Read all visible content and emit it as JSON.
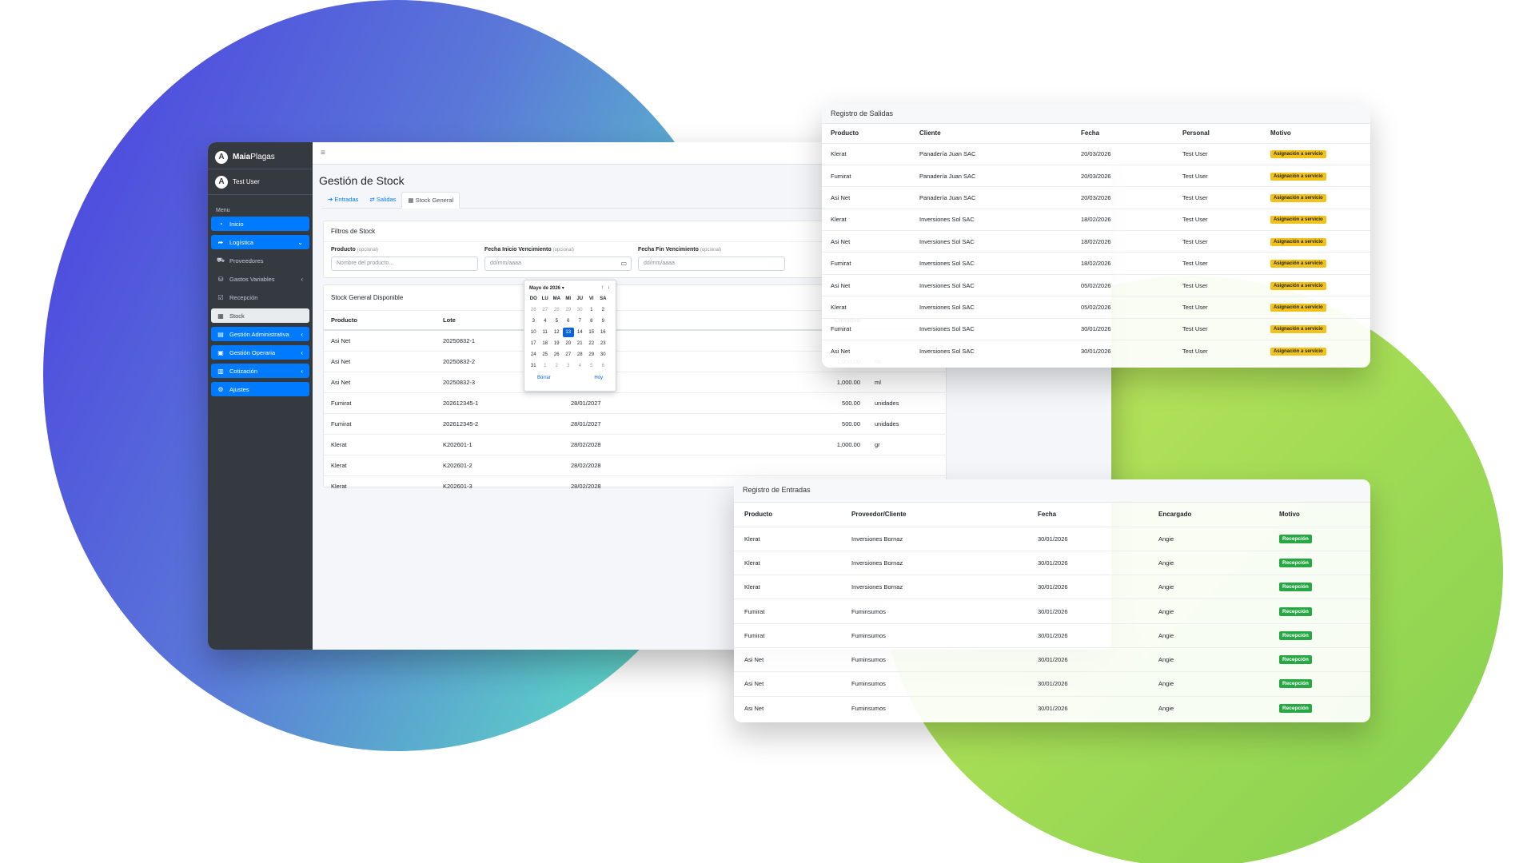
{
  "brand": {
    "name_bold": "Maia",
    "name_rest": "Plagas",
    "logo_letter": "A"
  },
  "user": {
    "name": "Test User"
  },
  "sidebar": {
    "menu_header": "Menu",
    "items": [
      {
        "label": "Inicio",
        "icon": "dashboard-icon",
        "glyph": "◔",
        "chev": ""
      },
      {
        "label": "Logística",
        "icon": "share-arrow-icon",
        "glyph": "➦",
        "chev": "⌄"
      },
      {
        "label": "Proveedores",
        "icon": "truck-icon",
        "glyph": "⛟",
        "chev": ""
      },
      {
        "label": "Gastos Variables",
        "icon": "coins-icon",
        "glyph": "⛁",
        "chev": "‹"
      },
      {
        "label": "Recepción",
        "icon": "check-box-icon",
        "glyph": "☑",
        "chev": ""
      },
      {
        "label": "Stock",
        "icon": "boxes-icon",
        "glyph": "▦",
        "chev": ""
      },
      {
        "label": "Gestión Administrativa",
        "icon": "document-icon",
        "glyph": "▤",
        "chev": "‹"
      },
      {
        "label": "Gestión Operaria",
        "icon": "briefcase-icon",
        "glyph": "▣",
        "chev": "‹"
      },
      {
        "label": "Cotización",
        "icon": "file-icon",
        "glyph": "▥",
        "chev": "‹"
      },
      {
        "label": "Ajustes",
        "icon": "gear-icon",
        "glyph": "⚙",
        "chev": ""
      }
    ]
  },
  "topbar": {
    "menu_glyph": "≡"
  },
  "page": {
    "title": "Gestión de Stock",
    "tabs": [
      {
        "label": "Entradas",
        "glyph": "➔"
      },
      {
        "label": "Salidas",
        "glyph": "⇄"
      },
      {
        "label": "Stock General",
        "glyph": "▦"
      }
    ]
  },
  "filters": {
    "title": "Filtros de Stock",
    "producto_label": "Producto",
    "optional": "(opcional)",
    "producto_placeholder": "Nombre del producto...",
    "fecha_inicio_label": "Fecha Inicio Vencimiento",
    "fecha_fin_label": "Fecha Fin Vencimiento",
    "date_placeholder": "dd/mm/aaaa"
  },
  "stock": {
    "title": "Stock General Disponible",
    "columns": [
      "Producto",
      "Lote",
      "cimiento",
      "Cantidad"
    ],
    "rows": [
      {
        "producto": "Asi Net",
        "lote": "20250832-1",
        "fecha": "",
        "cantidad": "",
        "unidad": ""
      },
      {
        "producto": "Asi Net",
        "lote": "20250832-2",
        "fecha": "",
        "cantidad": "1,000.00",
        "unidad": "ml"
      },
      {
        "producto": "Asi Net",
        "lote": "20250832-3",
        "fecha": "",
        "cantidad": "1,000.00",
        "unidad": "ml"
      },
      {
        "producto": "Fumirat",
        "lote": "202612345-1",
        "fecha": "28/01/2027",
        "cantidad": "500.00",
        "unidad": "unidades"
      },
      {
        "producto": "Fumirat",
        "lote": "202612345-2",
        "fecha": "28/01/2027",
        "cantidad": "500.00",
        "unidad": "unidades"
      },
      {
        "producto": "Klerat",
        "lote": "K202601-1",
        "fecha": "28/02/2028",
        "cantidad": "1,000.00",
        "unidad": "gr"
      },
      {
        "producto": "Klerat",
        "lote": "K202601-2",
        "fecha": "28/02/2028",
        "cantidad": "",
        "unidad": ""
      },
      {
        "producto": "Klerat",
        "lote": "K202601-3",
        "fecha": "28/02/2028",
        "cantidad": "",
        "unidad": ""
      }
    ]
  },
  "datepicker": {
    "month_label": "Mayo de 2026 ▾",
    "up": "↑",
    "down": "↓",
    "weekdays": [
      "DO",
      "LU",
      "MA",
      "MI",
      "JU",
      "VI",
      "SA"
    ],
    "days": [
      "26",
      "27",
      "28",
      "29",
      "30",
      "1",
      "2",
      "3",
      "4",
      "5",
      "6",
      "7",
      "8",
      "9",
      "10",
      "11",
      "12",
      "13",
      "14",
      "15",
      "16",
      "17",
      "18",
      "19",
      "20",
      "21",
      "22",
      "23",
      "24",
      "25",
      "26",
      "27",
      "28",
      "29",
      "30",
      "31",
      "1",
      "2",
      "3",
      "4",
      "5",
      "6"
    ],
    "selected": "13",
    "clear": "Borrar",
    "today": "Hoy"
  },
  "salidas": {
    "title": "Registro de Salidas",
    "columns": [
      "Producto",
      "Cliente",
      "Fecha",
      "Personal",
      "Motivo"
    ],
    "rows": [
      {
        "producto": "Klerat",
        "cliente": "Panadería Juan SAC",
        "fecha": "20/03/2026",
        "personal": "Test User",
        "motivo": "Asignación a servicio"
      },
      {
        "producto": "Fumirat",
        "cliente": "Panadería Juan SAC",
        "fecha": "20/03/2026",
        "personal": "Test User",
        "motivo": "Asignación a servicio"
      },
      {
        "producto": "Asi Net",
        "cliente": "Panadería Juan SAC",
        "fecha": "20/03/2026",
        "personal": "Test User",
        "motivo": "Asignación a servicio"
      },
      {
        "producto": "Klerat",
        "cliente": "Inversiones Sol SAC",
        "fecha": "18/02/2026",
        "personal": "Test User",
        "motivo": "Asignación a servicio"
      },
      {
        "producto": "Asi Net",
        "cliente": "Inversiones Sol SAC",
        "fecha": "18/02/2026",
        "personal": "Test User",
        "motivo": "Asignación a servicio"
      },
      {
        "producto": "Fumirat",
        "cliente": "Inversiones Sol SAC",
        "fecha": "18/02/2026",
        "personal": "Test User",
        "motivo": "Asignación a servicio"
      },
      {
        "producto": "Asi Net",
        "cliente": "Inversiones Sol SAC",
        "fecha": "05/02/2026",
        "personal": "Test User",
        "motivo": "Asignación a servicio"
      },
      {
        "producto": "Klerat",
        "cliente": "Inversiones Sol SAC",
        "fecha": "05/02/2026",
        "personal": "Test User",
        "motivo": "Asignación a servicio"
      },
      {
        "producto": "Fumirat",
        "cliente": "Inversiones Sol SAC",
        "fecha": "30/01/2026",
        "personal": "Test User",
        "motivo": "Asignación a servicio"
      },
      {
        "producto": "Asi Net",
        "cliente": "Inversiones Sol SAC",
        "fecha": "30/01/2026",
        "personal": "Test User",
        "motivo": "Asignación a servicio"
      }
    ]
  },
  "entradas": {
    "title": "Registro de Entradas",
    "columns": [
      "Producto",
      "Proveedor/Cliente",
      "Fecha",
      "Encargado",
      "Motivo"
    ],
    "rows": [
      {
        "producto": "Klerat",
        "proveedor": "Inversiones Bornaz",
        "fecha": "30/01/2026",
        "encargado": "Angie",
        "motivo": "Recepción"
      },
      {
        "producto": "Klerat",
        "proveedor": "Inversiones Bornaz",
        "fecha": "30/01/2026",
        "encargado": "Angie",
        "motivo": "Recepción"
      },
      {
        "producto": "Klerat",
        "proveedor": "Inversiones Bornaz",
        "fecha": "30/01/2026",
        "encargado": "Angie",
        "motivo": "Recepción"
      },
      {
        "producto": "Fumirat",
        "proveedor": "Fuminsumos",
        "fecha": "30/01/2026",
        "encargado": "Angie",
        "motivo": "Recepción"
      },
      {
        "producto": "Fumirat",
        "proveedor": "Fuminsumos",
        "fecha": "30/01/2026",
        "encargado": "Angie",
        "motivo": "Recepción"
      },
      {
        "producto": "Asi Net",
        "proveedor": "Fuminsumos",
        "fecha": "30/01/2026",
        "encargado": "Angie",
        "motivo": "Recepción"
      },
      {
        "producto": "Asi Net",
        "proveedor": "Fuminsumos",
        "fecha": "30/01/2026",
        "encargado": "Angie",
        "motivo": "Recepción"
      },
      {
        "producto": "Asi Net",
        "proveedor": "Fuminsumos",
        "fecha": "30/01/2026",
        "encargado": "Angie",
        "motivo": "Recepción"
      }
    ]
  },
  "colors": {
    "primary": "#007bff",
    "sidebar": "#343a40",
    "badge_warning": "#f2c21a",
    "badge_success": "#28a745"
  }
}
